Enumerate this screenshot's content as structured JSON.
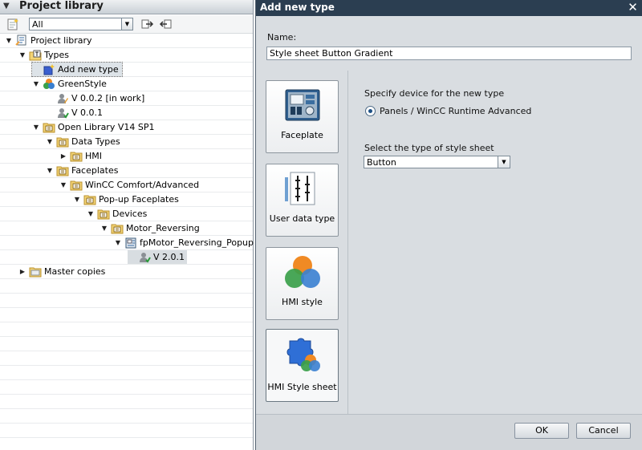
{
  "library": {
    "title": "Project library",
    "filter": {
      "value": "All"
    }
  },
  "tree": [
    {
      "label": "Project library",
      "depth": 0,
      "toggle": "down",
      "icon": "library-icon"
    },
    {
      "label": "Types",
      "depth": 1,
      "toggle": "down",
      "icon": "types-folder-icon"
    },
    {
      "label": "Add new type",
      "depth": 2,
      "toggle": "",
      "icon": "add-type-icon",
      "selected": true
    },
    {
      "label": "GreenStyle",
      "depth": 2,
      "toggle": "down",
      "icon": "style-icon"
    },
    {
      "label": "V 0.0.2 [in work]",
      "depth": 3,
      "toggle": "",
      "icon": "version-work-icon"
    },
    {
      "label": "V 0.0.1",
      "depth": 3,
      "toggle": "",
      "icon": "version-icon"
    },
    {
      "label": "Open Library V14 SP1",
      "depth": 2,
      "toggle": "down",
      "icon": "folder-icon"
    },
    {
      "label": "Data Types",
      "depth": 3,
      "toggle": "down",
      "icon": "folder-icon"
    },
    {
      "label": "HMI",
      "depth": 4,
      "toggle": "right",
      "icon": "folder-icon"
    },
    {
      "label": "Faceplates",
      "depth": 3,
      "toggle": "down",
      "icon": "folder-icon"
    },
    {
      "label": "WinCC Comfort/Advanced",
      "depth": 4,
      "toggle": "down",
      "icon": "folder-icon"
    },
    {
      "label": "Pop-up Faceplates",
      "depth": 5,
      "toggle": "down",
      "icon": "folder-icon"
    },
    {
      "label": "Devices",
      "depth": 6,
      "toggle": "down",
      "icon": "folder-icon"
    },
    {
      "label": "Motor_Reversing",
      "depth": 7,
      "toggle": "down",
      "icon": "folder-icon"
    },
    {
      "label": "fpMotor_Reversing_Popup",
      "depth": 8,
      "toggle": "down",
      "icon": "faceplate-type-icon"
    },
    {
      "label": "V 2.0.1",
      "depth": 9,
      "toggle": "",
      "icon": "version-icon",
      "current": true
    },
    {
      "label": "Master copies",
      "depth": 1,
      "toggle": "right",
      "icon": "master-copies-folder-icon"
    }
  ],
  "dialog": {
    "title": "Add new type",
    "name_label": "Name:",
    "name_value": "Style sheet Button Gradient",
    "types": [
      {
        "label": "Faceplate",
        "icon": "faceplate-icon"
      },
      {
        "label": "User data type",
        "icon": "user-data-type-icon"
      },
      {
        "label": "HMI style",
        "icon": "hmi-style-icon"
      },
      {
        "label": "HMI Style sheet",
        "icon": "hmi-style-sheet-icon",
        "active": true
      }
    ],
    "device_label": "Specify device for the new type",
    "device_option": "Panels / WinCC Runtime Advanced",
    "sheet_label": "Select the type of style sheet",
    "sheet_value": "Button",
    "ok_label": "OK",
    "cancel_label": "Cancel"
  }
}
